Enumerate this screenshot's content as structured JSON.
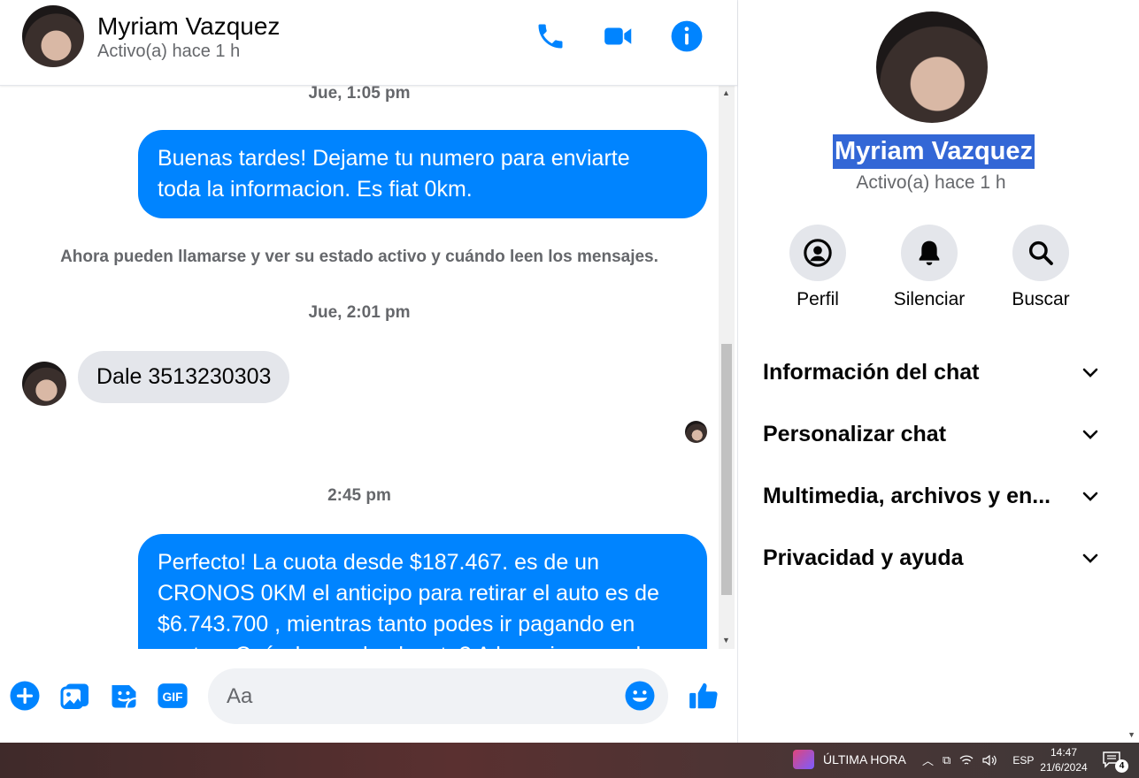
{
  "header": {
    "name": "Myriam Vazquez",
    "status": "Activo(a) hace 1 h",
    "accent": "#0084ff"
  },
  "messages": {
    "ts1": "Jue, 1:05 pm",
    "out1": [
      "Buenas tardes! Dejame tu numero para enviarte",
      "toda la informacion. Es fiat 0km."
    ],
    "notice": "Ahora pueden llamarse y ver su estado activo y cuándo leen los mensajes.",
    "ts2": "Jue, 2:01 pm",
    "in1": "Dale 3513230303",
    "ts3": "2:45 pm",
    "out2": [
      "Perfecto! La cuota desde $187.467. es de un",
      "CRONOS 0KM el anticipo para retirar el auto es de",
      "$6.743.700 , mientras tanto podes ir pagando en",
      "cuotas. Cuándo queda el resto? A lo mejor cuando"
    ]
  },
  "composer": {
    "placeholder": "Aa",
    "icons": [
      "plus-icon",
      "image-icon",
      "sticker-icon",
      "gif-icon",
      "emoji-icon",
      "like-icon"
    ]
  },
  "info": {
    "name": "Myriam Vazquez",
    "status": "Activo(a) hace 1 h",
    "actions": [
      {
        "label": "Perfil",
        "icon": "profile-icon"
      },
      {
        "label": "Silenciar",
        "icon": "bell-icon"
      },
      {
        "label": "Buscar",
        "icon": "search-icon"
      }
    ],
    "sections": [
      "Información del chat",
      "Personalizar chat",
      "Multimedia, archivos y en...",
      "Privacidad y ayuda"
    ]
  },
  "taskbar": {
    "news": "ÚLTIMA HORA",
    "language": "ESP",
    "time": "14:47",
    "date": "21/6/2024",
    "notifications": "4"
  }
}
